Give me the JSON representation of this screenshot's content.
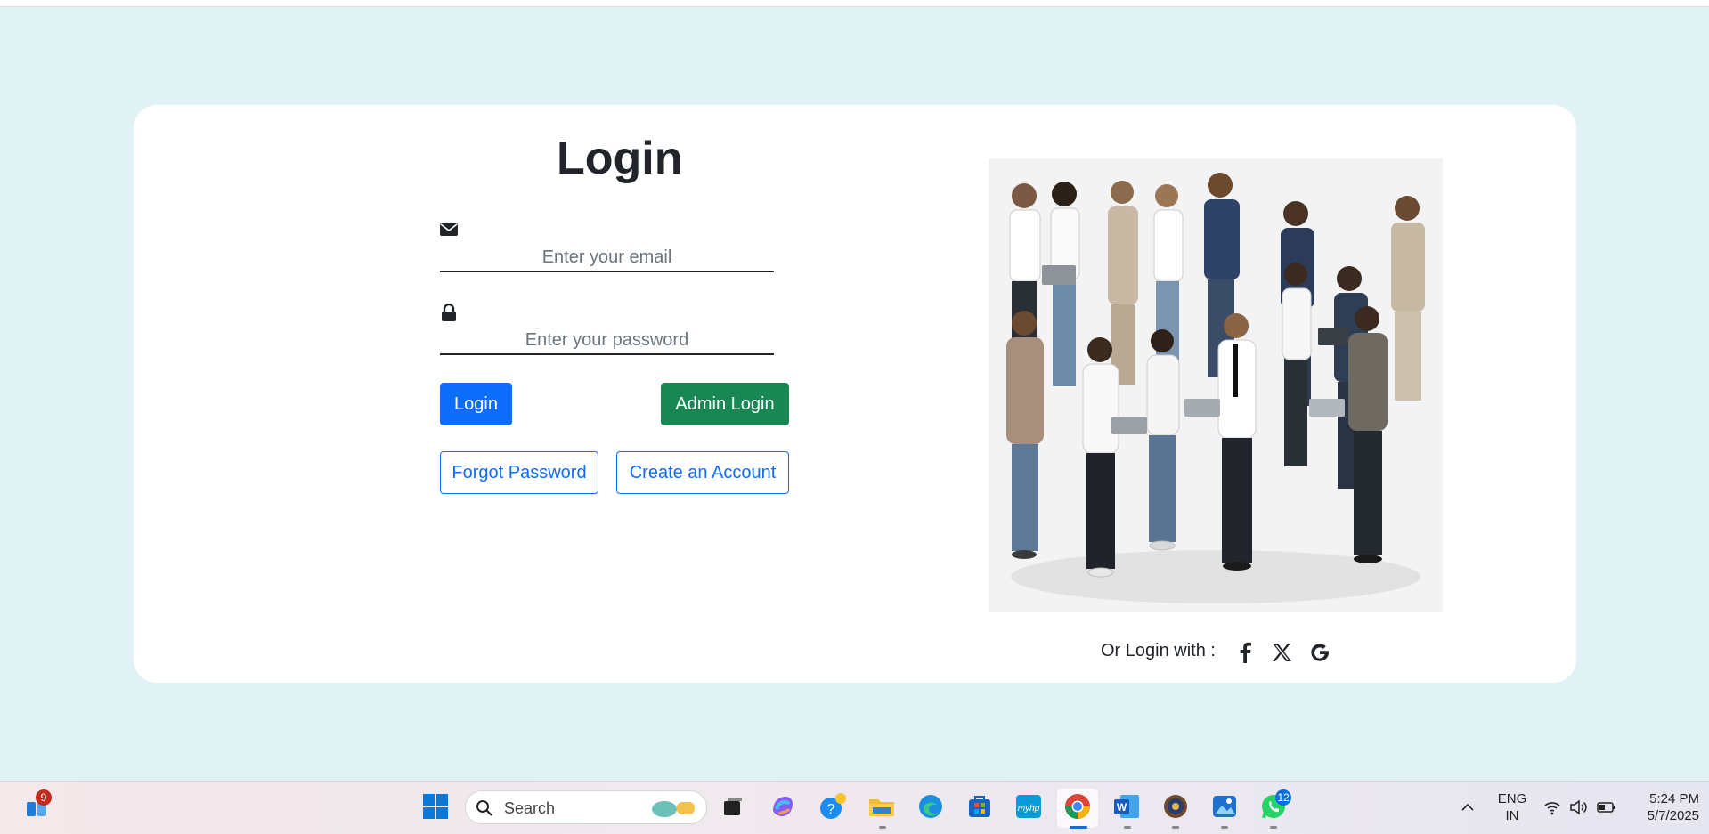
{
  "login": {
    "title": "Login",
    "email_placeholder": "Enter your email",
    "password_placeholder": "Enter your password",
    "login_button": "Login",
    "admin_login_button": "Admin Login",
    "forgot_password_link": "Forgot Password",
    "create_account_link": "Create an Account",
    "social_label": "Or Login with :",
    "social_icons": [
      "facebook-icon",
      "x-icon",
      "google-icon"
    ]
  },
  "colors": {
    "page_bg": "#e0f2f4",
    "primary": "#0d6efd",
    "success": "#198754"
  },
  "taskbar": {
    "search_placeholder": "Search",
    "widgets_badge": "9",
    "whatsapp_badge": "12",
    "language": "ENG",
    "region": "IN",
    "time": "5:24 PM",
    "date": "5/7/2025"
  }
}
